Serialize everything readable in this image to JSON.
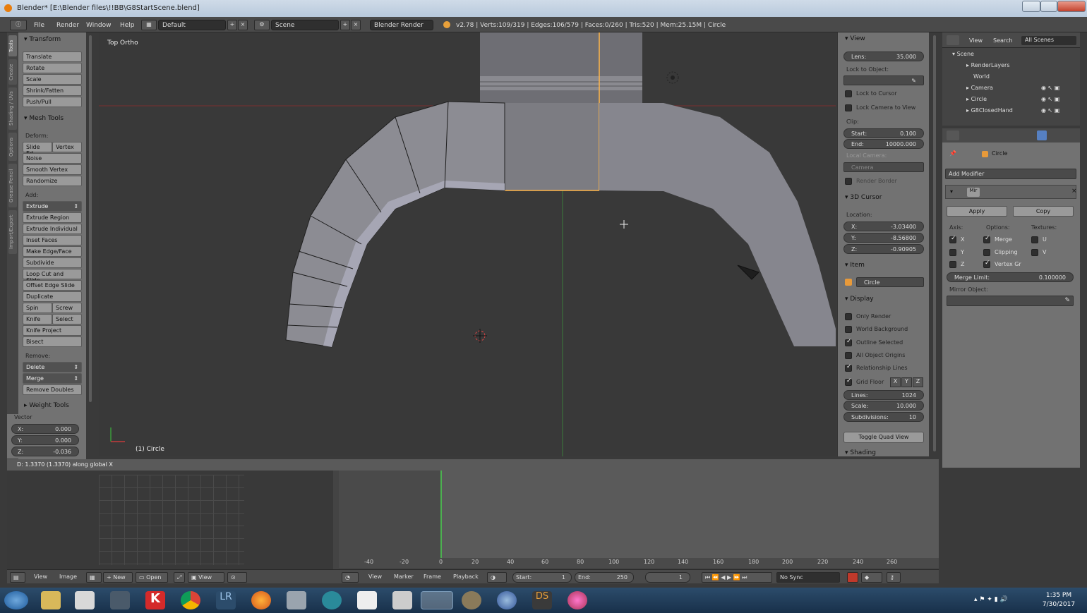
{
  "window": {
    "title": "Blender* [E:\\Blender files\\!!BB\\G8StartScene.blend]"
  },
  "info_header": {
    "menus": [
      "File",
      "Render",
      "Window",
      "Help"
    ],
    "layout": "Default",
    "scene": "Scene",
    "engine": "Blender Render",
    "stats": "v2.78 | Verts:109/319 | Edges:106/579 | Faces:0/260 | Tris:520 | Mem:25.15M | Circle"
  },
  "side_tabs": [
    "Tools",
    "Create",
    "Shading / UVs",
    "Options",
    "Grease Pencil",
    "Import/Export"
  ],
  "tool_shelf": {
    "transform_header": "Transform",
    "transform_buttons": [
      "Translate",
      "Rotate",
      "Scale",
      "Shrink/Fatten",
      "Push/Pull"
    ],
    "mesh_tools_header": "Mesh Tools",
    "deform_label": "Deform:",
    "deform_pair": [
      "Slide Ed",
      "Vertex"
    ],
    "deform_buttons": [
      "Noise",
      "Smooth Vertex",
      "Randomize"
    ],
    "add_label": "Add:",
    "add_dropdown": "Extrude",
    "add_buttons": [
      "Extrude Region",
      "Extrude Individual",
      "Inset Faces",
      "Make Edge/Face",
      "Subdivide",
      "Loop Cut and Slide",
      "Offset Edge Slide",
      "Duplicate"
    ],
    "add_pairs": [
      [
        "Spin",
        "Screw"
      ],
      [
        "Knife",
        "Select"
      ]
    ],
    "add_buttons2": [
      "Knife Project",
      "Bisect"
    ],
    "remove_label": "Remove:",
    "remove_dropdowns": [
      "Delete",
      "Merge"
    ],
    "remove_buttons": [
      "Remove Doubles"
    ],
    "weight_tools_header": "Weight Tools"
  },
  "vector_panel": {
    "title": "Vector",
    "fields": [
      {
        "label": "X:",
        "value": "0.000"
      },
      {
        "label": "Y:",
        "value": "0.000"
      },
      {
        "label": "Z:",
        "value": "-0.036"
      }
    ]
  },
  "viewport": {
    "view_name": "Top Ortho",
    "object_label": "(1) Circle",
    "status": "D: 1.3370 (1.3370) along global X"
  },
  "n_panel": {
    "view_header": "View",
    "lens_label": "Lens:",
    "lens_value": "35.000",
    "lock_to_object": "Lock to Object:",
    "lock_to_cursor": "Lock to Cursor",
    "lock_camera": "Lock Camera to View",
    "clip": "Clip:",
    "clip_start_label": "Start:",
    "clip_start": "0.100",
    "clip_end_label": "End:",
    "clip_end": "10000.000",
    "local_camera": "Local Camera:",
    "camera_field": "Camera",
    "render_border": "Render Border",
    "cursor_header": "3D Cursor",
    "location": "Location:",
    "cursor": [
      {
        "label": "X:",
        "value": "-3.03400"
      },
      {
        "label": "Y:",
        "value": "-8.56800"
      },
      {
        "label": "Z:",
        "value": "-0.90905"
      }
    ],
    "item_header": "Item",
    "item_name": "Circle",
    "display_header": "Display",
    "display_options": [
      {
        "label": "Only Render",
        "checked": false
      },
      {
        "label": "World Background",
        "checked": false
      },
      {
        "label": "Outline Selected",
        "checked": true
      },
      {
        "label": "All Object Origins",
        "checked": false
      },
      {
        "label": "Relationship Lines",
        "checked": true
      }
    ],
    "grid_floor": "Grid Floor",
    "grid_axes": [
      "X",
      "Y",
      "Z"
    ],
    "lines_label": "Lines:",
    "lines_value": "1024",
    "scale_label": "Scale:",
    "scale_value": "10.000",
    "subdivisions_label": "Subdivisions:",
    "subdivisions_value": "10",
    "toggle_quad": "Toggle Quad View",
    "shading_header": "Shading"
  },
  "outliner": {
    "header": [
      "View",
      "Search",
      "All Scenes"
    ],
    "items": [
      "Scene",
      "RenderLayers",
      "World",
      "Camera",
      "Circle",
      "G8ClosedHand"
    ]
  },
  "properties": {
    "object_name": "Circle",
    "add_modifier": "Add Modifier",
    "modifier_name": "Mir",
    "apply": "Apply",
    "copy": "Copy",
    "axis_label": "Axis:",
    "options_label": "Options:",
    "textures_label": "Textures:",
    "axes": [
      {
        "label": "X",
        "checked": true
      },
      {
        "label": "Y",
        "checked": false
      },
      {
        "label": "Z",
        "checked": false
      }
    ],
    "options": [
      {
        "label": "Merge",
        "checked": true
      },
      {
        "label": "Clipping",
        "checked": false
      },
      {
        "label": "Vertex Gr",
        "checked": true
      }
    ],
    "textures": [
      {
        "label": "U",
        "checked": false
      },
      {
        "label": "V",
        "checked": false
      }
    ],
    "merge_limit_label": "Merge Limit:",
    "merge_limit_value": "0.100000",
    "mirror_object": "Mirror Object:"
  },
  "timeline": {
    "ticks": [
      "-40",
      "-20",
      "0",
      "20",
      "40",
      "60",
      "80",
      "100",
      "120",
      "140",
      "160",
      "180",
      "200",
      "220",
      "240",
      "260"
    ],
    "current_frame": 1,
    "uv_menus": [
      "View",
      "Image"
    ],
    "uv_new": "New",
    "uv_open": "Open",
    "uv_view": "View",
    "tl_menus": [
      "View",
      "Marker",
      "Frame",
      "Playback"
    ],
    "start_label": "Start:",
    "start_value": "1",
    "end_label": "End:",
    "end_value": "250",
    "frame_value": "1",
    "sync": "No Sync"
  },
  "taskbar": {
    "time": "1:35 PM",
    "date": "7/30/2017"
  },
  "colors": {
    "accent_orange": "#f5a623",
    "selected_edge": "#ffb54a",
    "grid_red": "#8a3a3a",
    "grid_green": "#3a7a3a"
  }
}
